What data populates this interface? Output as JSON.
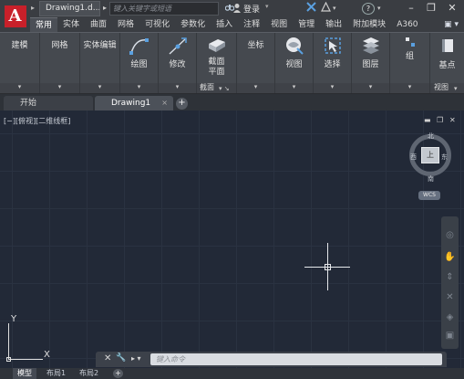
{
  "titlebar": {
    "app_letter": "A",
    "doc_title": "Drawing1.d...",
    "search_placeholder": "键入关键字或短语",
    "login": "登录",
    "help": "?",
    "qat_arrow": "▸",
    "doc_more": "▸",
    "login_caret": "▾",
    "minimize": "–",
    "restore": "❐",
    "close": "✕"
  },
  "ribbon_tabs": [
    "常用",
    "实体",
    "曲面",
    "网格",
    "可视化",
    "参数化",
    "插入",
    "注释",
    "视图",
    "管理",
    "输出",
    "附加模块",
    "A360"
  ],
  "ribbon_tab_active": 0,
  "ribbon_tab_extra": "▣ ▾",
  "ribbon_panels": {
    "modeling": "建模",
    "mesh": "网格",
    "solid_edit": "实体编辑",
    "draw": "绘图",
    "modify": "修改",
    "section_plane_1": "截面",
    "section_plane_2": "平面",
    "section": "截面",
    "section_caret": "▾ ↘",
    "coordinates": "坐标",
    "view": "视图",
    "selection": "选择",
    "layers": "图层",
    "groups": "组",
    "base_point": "基点",
    "view_panel": "视图",
    "caret": "▾"
  },
  "file_tabs": [
    {
      "label": "开始"
    },
    {
      "label": "Drawing1"
    }
  ],
  "file_tab_close": "×",
  "file_tab_add": "+",
  "viewport": {
    "label": "[−][俯视][二维线框]",
    "minimize": "▬",
    "restore": "❐",
    "close": "✕"
  },
  "viewcube": {
    "top": "上",
    "north": "北",
    "south": "南",
    "east": "东",
    "west": "西",
    "wcs": "WCS"
  },
  "navbar_icons": [
    "◎",
    "✋",
    "⇕",
    "✕",
    "◈",
    "▣"
  ],
  "ucs": {
    "x": "X",
    "y": "Y"
  },
  "command": {
    "placeholder": "键入命令",
    "close": "✕",
    "settings": "🔧",
    "prompt": "▸ ▾"
  },
  "layout_tabs": [
    "模型",
    "布局1",
    "布局2"
  ],
  "layout_tab_add": "+"
}
